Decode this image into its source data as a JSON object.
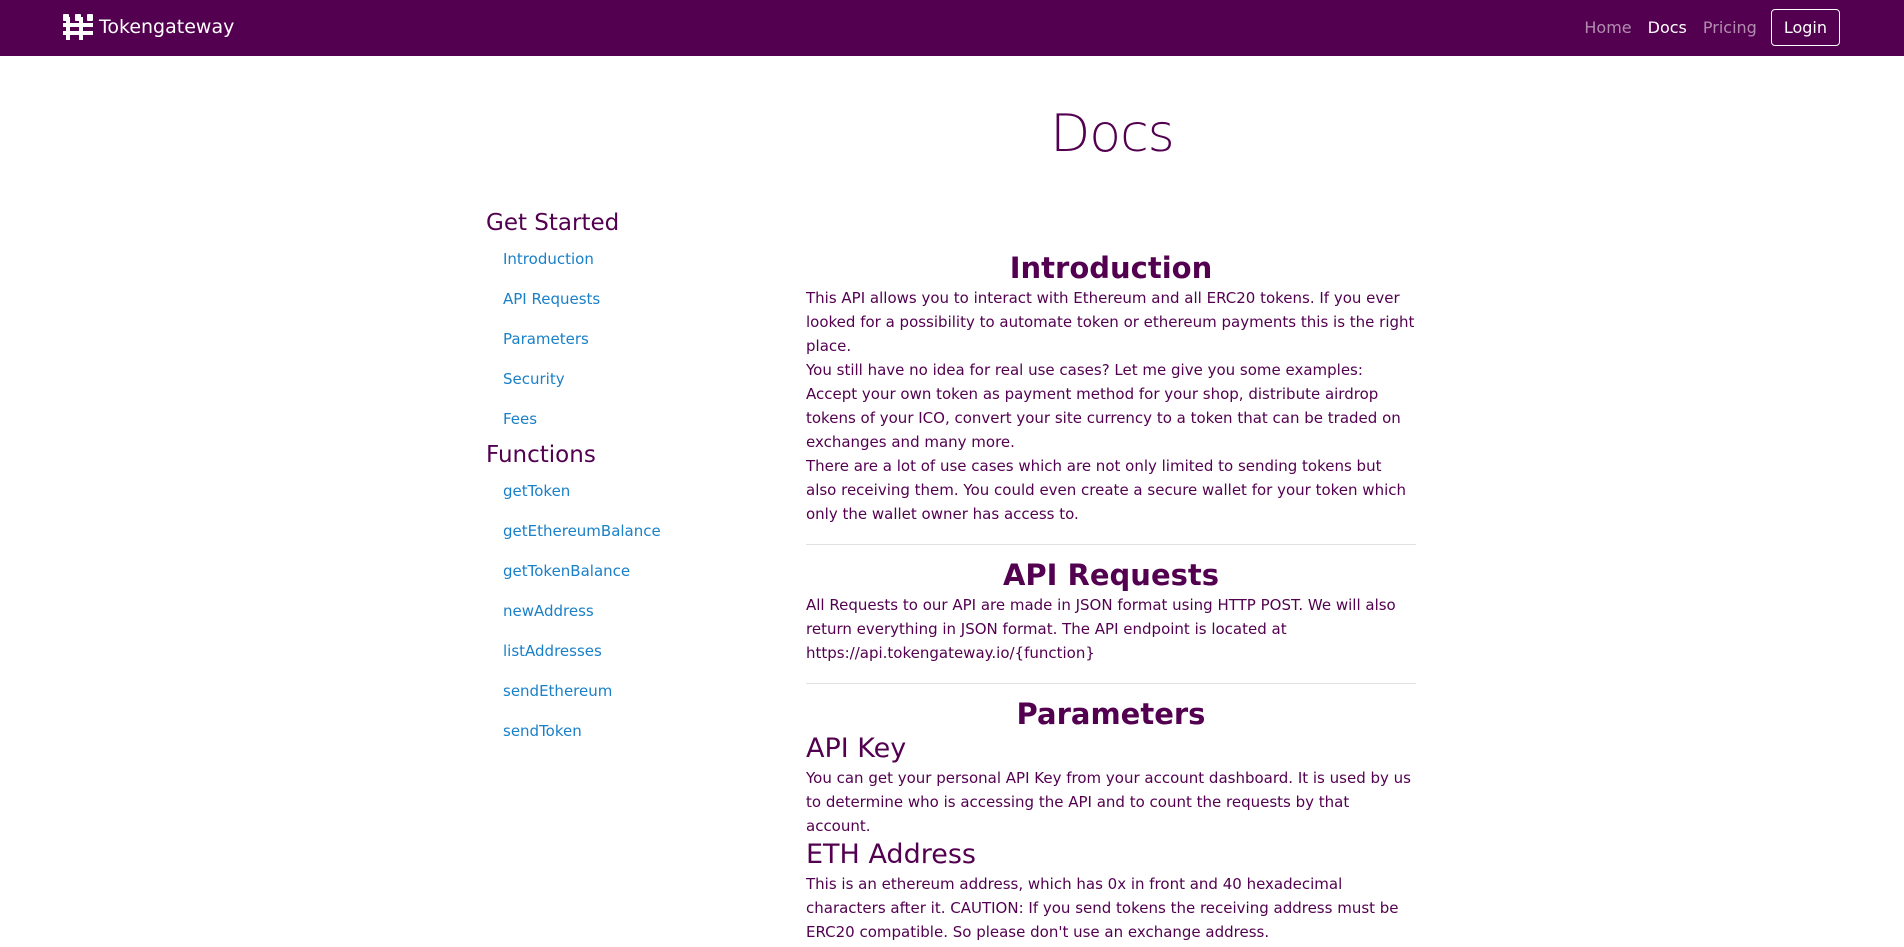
{
  "brand": {
    "name": "Tokengateway",
    "icon": "tokengateway-logo-icon"
  },
  "nav": {
    "links": [
      {
        "label": "Home",
        "active": false
      },
      {
        "label": "Docs",
        "active": true
      },
      {
        "label": "Pricing",
        "active": false
      }
    ],
    "login_label": "Login"
  },
  "page_title": "Docs",
  "sidebar": {
    "sections": [
      {
        "heading": "Get Started",
        "items": [
          "Introduction",
          "API Requests",
          "Parameters",
          "Security",
          "Fees"
        ]
      },
      {
        "heading": "Functions",
        "items": [
          "getToken",
          "getEthereumBalance",
          "getTokenBalance",
          "newAddress",
          "listAddresses",
          "sendEthereum",
          "sendToken"
        ]
      }
    ]
  },
  "content": {
    "introduction": {
      "title": "Introduction",
      "p1": "This API allows you to interact with Ethereum and all ERC20 tokens. If you ever looked for a possibility to automate token or ethereum payments this is the right place.",
      "p2": "You still have no idea for real use cases? Let me give you some examples: Accept your own token as payment method for your shop, distribute airdrop tokens of your ICO, convert your site currency to a token that can be traded on exchanges and many more.",
      "p3": "There are a lot of use cases which are not only limited to sending tokens but also receiving them. You could even create a secure wallet for your token which only the wallet owner has access to."
    },
    "api_requests": {
      "title": "API Requests",
      "p1": "All Requests to our API are made in JSON format using HTTP POST. We will also return everything in JSON format. The API endpoint is located at https://api.tokengateway.io/{function}"
    },
    "parameters": {
      "title": "Parameters",
      "api_key": {
        "title": "API Key",
        "text": "You can get your personal API Key from your account dashboard. It is used by us to determine who is accessing the API and to count the requests by that account."
      },
      "eth_address": {
        "title": "ETH Address",
        "text": "This is an ethereum address, which has 0x in front and 40 hexadecimal characters after it. CAUTION: If you send tokens the receiving address must be ERC20 compatible. So please don't use an exchange address."
      }
    }
  },
  "colors": {
    "brand": "#52004f",
    "link": "#1a80c8",
    "text": "#52004f"
  }
}
